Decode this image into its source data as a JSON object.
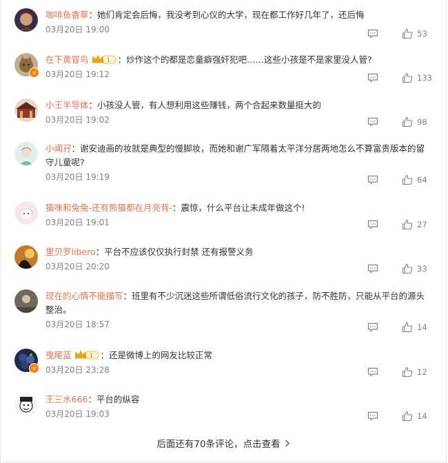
{
  "comments": [
    {
      "user": "咖啡鱼香草",
      "crown": false,
      "vip": false,
      "text": "：她们肯定会后悔，我没考到心仪的大学，现在都工作好几年了，还后悔",
      "time": "03月20日 19:00",
      "likes": "53"
    },
    {
      "user": "在下黄冒鸟",
      "crown": true,
      "vip": true,
      "text": "：炒作这个的都是恋童癖强奸犯吧……这些小孩是不是家里没人管?",
      "time": "03月20日 19:12",
      "likes": "133"
    },
    {
      "user": "小王半导体",
      "crown": false,
      "vip": false,
      "text": "：小孩没人管，有人想利用这些赚钱，两个合起来数量挺大的",
      "time": "03月20日 19:02",
      "likes": "98"
    },
    {
      "user": "小闻孖",
      "crown": false,
      "vip": false,
      "text": "：谢安迪画的妆就是典型的慢脚妆，而她和谢广军隔着太平洋分居两地怎么不算富贵版本的留守儿童呢?",
      "time": "03月20日 19:19",
      "likes": "64"
    },
    {
      "user": "猫咪和兔兔-还有熊猫都在月亮背-",
      "crown": false,
      "vip": false,
      "text": "：震惊，什么平台让未成年做这个!",
      "time": "03月20日 19:01",
      "likes": "27"
    },
    {
      "user": "里贝罗libero",
      "crown": false,
      "vip": false,
      "text": "：平台不应该仅仅执行封禁 还有报警义务",
      "time": "03月20日 20:20",
      "likes": "33"
    },
    {
      "user": "现在的心情不能描写",
      "crown": false,
      "vip": false,
      "text": "：班里有不少沉迷这些所谓低俗流行文化的孩子，防不胜防，只能从平台的源头整治。",
      "time": "03月20日 18:57",
      "likes": "14"
    },
    {
      "user": "曳尾蓝",
      "crown": true,
      "vip": true,
      "text": "：还是微博上的网友比较正常",
      "time": "03月20日 23:28",
      "likes": "12"
    },
    {
      "user": "王三水666",
      "crown": false,
      "vip": false,
      "text": "：平台的纵容",
      "time": "03月20日 19:03",
      "likes": "14"
    }
  ],
  "crown_level": "1",
  "vip_mark": "v",
  "more_link": "后面还有70条评论，点击查看",
  "colors": {
    "username": "#eb7350",
    "time": "#808080",
    "vip": "#ff8200",
    "crown": "#f0a800"
  }
}
